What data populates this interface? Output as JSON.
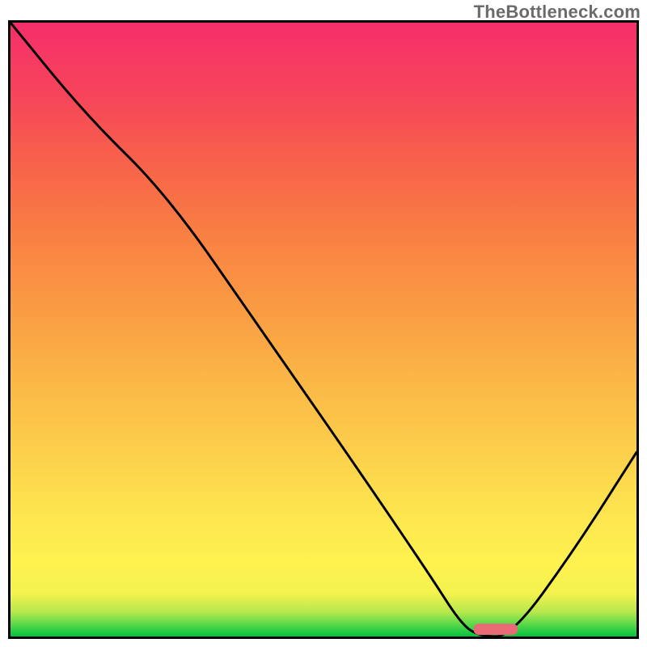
{
  "watermark": "TheBottleneck.com",
  "chart_data": {
    "type": "line",
    "title": "",
    "xlabel": "",
    "ylabel": "",
    "xlim": [
      0,
      100
    ],
    "ylim": [
      0,
      100
    ],
    "grid": false,
    "series": [
      {
        "name": "bottleneck-curve",
        "x": [
          0,
          12,
          25,
          40,
          55,
          67,
          72,
          75,
          80,
          90,
          100
        ],
        "values": [
          100,
          85,
          72,
          50,
          28,
          10,
          2,
          0,
          0,
          14,
          30
        ]
      }
    ],
    "marker": {
      "x_start": 74,
      "x_end": 81,
      "y": 0,
      "color": "#e96a75"
    },
    "background": "vertical-spectrum-green-to-red",
    "legend": false
  }
}
